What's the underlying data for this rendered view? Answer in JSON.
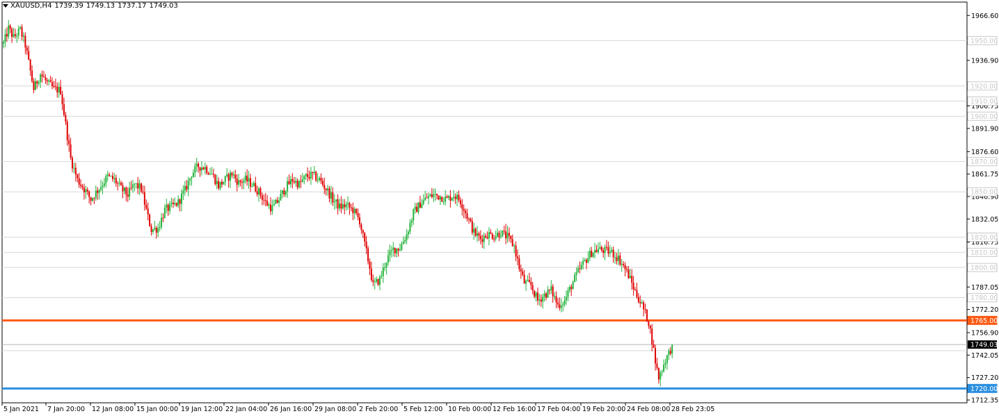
{
  "header": {
    "symbol": "XAUUSD,H4",
    "open": "1739.39",
    "high": "1749.13",
    "low": "1737.17",
    "close": "1749.03"
  },
  "colors": {
    "bull": "#22b33a",
    "bear": "#e00000",
    "grid": "#d6d6d6",
    "axis": "#000000",
    "resistance_line": "#ff5a14",
    "support_line": "#2b8fe0",
    "current_price_box": "#000000",
    "faint_label": "#c8c8c8"
  },
  "chart_data": {
    "type": "candlestick",
    "ylim": [
      1712.35,
      1970.4
    ],
    "y_ticks": [
      "1966.60",
      "1936.90",
      "1906.75",
      "1891.90",
      "1876.60",
      "1861.75",
      "1846.90",
      "1832.05",
      "1816.75",
      "1787.05",
      "1772.20",
      "1756.90",
      "1742.05",
      "1727.20",
      "1712.35"
    ],
    "x_ticks": [
      "5 Jan 2021",
      "7 Jan 20:00",
      "12 Jan 08:00",
      "15 Jan 00:00",
      "19 Jan 12:00",
      "22 Jan 04:00",
      "26 Jan 16:00",
      "29 Jan 08:00",
      "2 Feb 20:00",
      "5 Feb 12:00",
      "10 Feb 00:00",
      "12 Feb 16:00",
      "17 Feb 04:00",
      "19 Feb 20:00",
      "24 Feb 08:00",
      "28 Feb 23:05"
    ],
    "horizontal_levels": [
      {
        "value": 1950.0,
        "label": "1950.00",
        "style": "faint"
      },
      {
        "value": 1920.0,
        "label": "1920.00",
        "style": "faint"
      },
      {
        "value": 1910.0,
        "label": "1910.00",
        "style": "faint"
      },
      {
        "value": 1900.0,
        "label": "1900.00",
        "style": "faint"
      },
      {
        "value": 1870.0,
        "label": "1870.00",
        "style": "faint"
      },
      {
        "value": 1850.0,
        "label": "1850.00",
        "style": "faint"
      },
      {
        "value": 1820.0,
        "label": "1820.00",
        "style": "faint"
      },
      {
        "value": 1810.0,
        "label": "1810.00",
        "style": "faint"
      },
      {
        "value": 1800.0,
        "label": "1800.00",
        "style": "faint"
      },
      {
        "value": 1780.0,
        "label": "1780.00",
        "style": "faint"
      },
      {
        "value": 1765.0,
        "label": "1765.00",
        "style": "resistance"
      },
      {
        "value": 1745.0,
        "label": "",
        "style": "faint"
      },
      {
        "value": 1720.0,
        "label": "1720.00",
        "style": "support"
      }
    ],
    "current_price": {
      "value": 1749.03,
      "label": "1749.03"
    },
    "anchors": [
      [
        0,
        1948
      ],
      [
        3,
        1958
      ],
      [
        6,
        1952
      ],
      [
        10,
        1957
      ],
      [
        13,
        1947
      ],
      [
        18,
        1918
      ],
      [
        22,
        1928
      ],
      [
        26,
        1922
      ],
      [
        30,
        1918
      ],
      [
        34,
        1917
      ],
      [
        36,
        1902
      ],
      [
        40,
        1872
      ],
      [
        44,
        1858
      ],
      [
        48,
        1852
      ],
      [
        52,
        1845
      ],
      [
        56,
        1851
      ],
      [
        62,
        1860
      ],
      [
        66,
        1858
      ],
      [
        70,
        1852
      ],
      [
        74,
        1848
      ],
      [
        78,
        1855
      ],
      [
        82,
        1852
      ],
      [
        86,
        1833
      ],
      [
        88,
        1825
      ],
      [
        92,
        1826
      ],
      [
        96,
        1838
      ],
      [
        100,
        1840
      ],
      [
        104,
        1843
      ],
      [
        108,
        1851
      ],
      [
        112,
        1862
      ],
      [
        116,
        1867
      ],
      [
        120,
        1866
      ],
      [
        124,
        1862
      ],
      [
        128,
        1854
      ],
      [
        132,
        1858
      ],
      [
        136,
        1862
      ],
      [
        140,
        1856
      ],
      [
        144,
        1858
      ],
      [
        148,
        1855
      ],
      [
        152,
        1850
      ],
      [
        156,
        1843
      ],
      [
        160,
        1839
      ],
      [
        164,
        1845
      ],
      [
        168,
        1853
      ],
      [
        172,
        1858
      ],
      [
        176,
        1855
      ],
      [
        180,
        1860
      ],
      [
        184,
        1861
      ],
      [
        188,
        1858
      ],
      [
        192,
        1852
      ],
      [
        196,
        1845
      ],
      [
        200,
        1840
      ],
      [
        204,
        1841
      ],
      [
        208,
        1838
      ],
      [
        212,
        1831
      ],
      [
        215,
        1815
      ],
      [
        218,
        1800
      ],
      [
        220,
        1788
      ],
      [
        224,
        1792
      ],
      [
        228,
        1805
      ],
      [
        232,
        1812
      ],
      [
        236,
        1813
      ],
      [
        240,
        1822
      ],
      [
        244,
        1836
      ],
      [
        248,
        1842
      ],
      [
        252,
        1846
      ],
      [
        256,
        1848
      ],
      [
        260,
        1847
      ],
      [
        264,
        1845
      ],
      [
        268,
        1848
      ],
      [
        272,
        1844
      ],
      [
        276,
        1834
      ],
      [
        280,
        1823
      ],
      [
        284,
        1819
      ],
      [
        288,
        1822
      ],
      [
        292,
        1821
      ],
      [
        296,
        1823
      ],
      [
        300,
        1820
      ],
      [
        304,
        1814
      ],
      [
        307,
        1800
      ],
      [
        310,
        1790
      ],
      [
        314,
        1788
      ],
      [
        318,
        1778
      ],
      [
        322,
        1782
      ],
      [
        326,
        1785
      ],
      [
        330,
        1775
      ],
      [
        334,
        1778
      ],
      [
        338,
        1788
      ],
      [
        342,
        1797
      ],
      [
        346,
        1804
      ],
      [
        350,
        1810
      ],
      [
        354,
        1812
      ],
      [
        358,
        1811
      ],
      [
        362,
        1810
      ],
      [
        366,
        1806
      ],
      [
        369,
        1801
      ],
      [
        372,
        1795
      ],
      [
        376,
        1784
      ],
      [
        380,
        1775
      ],
      [
        384,
        1764
      ],
      [
        386,
        1752
      ],
      [
        388,
        1738
      ],
      [
        390,
        1727
      ],
      [
        392,
        1733
      ],
      [
        394,
        1739
      ],
      [
        396,
        1743
      ],
      [
        398,
        1749
      ]
    ]
  }
}
